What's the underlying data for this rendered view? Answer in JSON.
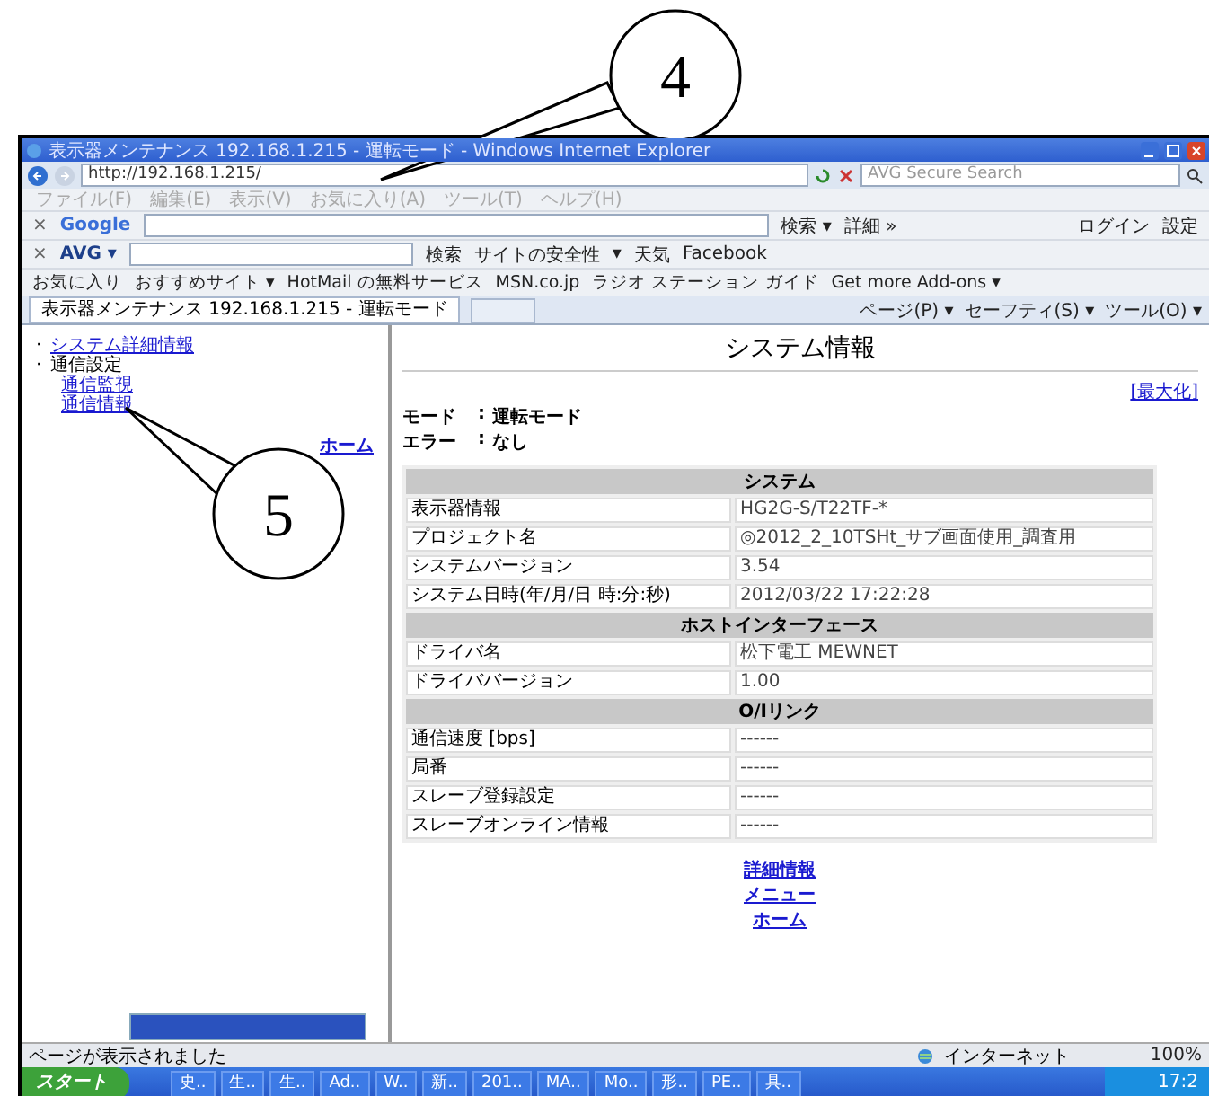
{
  "window": {
    "title": "表示器メンテナンス 192.168.1.215 - 運転モード - Windows Internet Explorer"
  },
  "address_bar": {
    "url": "http://192.168.1.215/",
    "search_placeholder": "AVG Secure Search"
  },
  "menu": [
    "ファイル(F)",
    "編集(E)",
    "表示(V)",
    "お気に入り(A)",
    "ツール(T)",
    "ヘルプ(H)"
  ],
  "google_toolbar": {
    "close": "×",
    "logo": "Google",
    "search_button": "検索 ▾",
    "more": "詳細 »",
    "login": "ログイン",
    "settings": "設定"
  },
  "avg_toolbar": {
    "close": "×",
    "logo": "AVG ▾",
    "search_button": "検索",
    "items": [
      "サイトの安全性",
      "▾",
      "天気",
      "Facebook"
    ]
  },
  "favorites_bar": {
    "label": "お気に入り",
    "items": [
      "おすすめサイト ▾",
      "HotMail の無料サービス",
      "MSN.co.jp",
      "ラジオ ステーション ガイド",
      "Get more Add-ons ▾"
    ]
  },
  "tabs": [
    {
      "label": "表示器メンテナンス 192.168.1.215 - 運転モード",
      "selected": true
    }
  ],
  "command_bar": [
    "ページ(P) ▾",
    "セーフティ(S) ▾",
    "ツール(O) ▾"
  ],
  "sidebar": {
    "items": [
      {
        "marker": "·",
        "label": "システム詳細情報",
        "link": true
      },
      {
        "marker": "·",
        "label": "通信設定",
        "link": false,
        "children": [
          {
            "label": "通信監視",
            "link": true
          },
          {
            "label": "通信情報",
            "link": true
          }
        ]
      }
    ],
    "home_link": "ホーム"
  },
  "page": {
    "title": "システム情報",
    "maximize_link": "[最大化]",
    "status": [
      {
        "label": "モード",
        "separator": ":",
        "value": "運転モード"
      },
      {
        "label": "エラー",
        "separator": ":",
        "value": "なし"
      }
    ],
    "sections": [
      {
        "title": "システム",
        "rows": [
          {
            "label": "表示器情報",
            "value": "HG2G-S/T22TF-*"
          },
          {
            "label": "プロジェクト名",
            "value": "◎2012_2_10TSHt_サブ画面使用_調査用"
          },
          {
            "label": "システムバージョン",
            "value": "3.54"
          },
          {
            "label": "システム日時(年/月/日 時:分:秒)",
            "value": "2012/03/22 17:22:28"
          }
        ]
      },
      {
        "title": "ホストインターフェース",
        "rows": [
          {
            "label": "ドライバ名",
            "value": "松下電工 MEWNET"
          },
          {
            "label": "ドライババージョン",
            "value": "1.00"
          }
        ]
      },
      {
        "title": "O/Iリンク",
        "rows": [
          {
            "label": "通信速度 [bps]",
            "value": "------"
          },
          {
            "label": "局番",
            "value": "------"
          },
          {
            "label": "スレーブ登録設定",
            "value": "------"
          },
          {
            "label": "スレーブオンライン情報",
            "value": "------"
          }
        ]
      }
    ],
    "links": [
      "詳細情報",
      "メニュー",
      "ホーム"
    ]
  },
  "status_bar": {
    "text": "ページが表示されました",
    "zone": "インターネット",
    "zoom": "100%"
  },
  "taskbar": {
    "start": "スタート",
    "buttons": [
      "史..",
      "生..",
      "生..",
      "Ad..",
      "W..",
      "新..",
      "201..",
      "MA..",
      "Mo..",
      "形..",
      "PE..",
      "具.."
    ],
    "clock": "17:2"
  },
  "callouts": [
    {
      "label": "4"
    },
    {
      "label": "5"
    }
  ]
}
